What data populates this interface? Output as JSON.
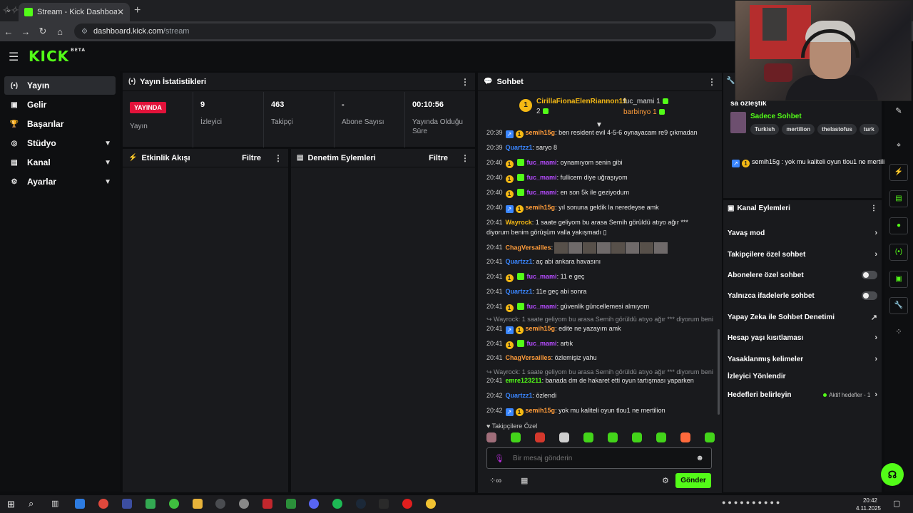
{
  "browser": {
    "tab_title": "Stream - Kick Dashboard",
    "tab_close": "✕",
    "new_tab": "+",
    "address_host": "dashboard.kick.com",
    "address_path": "/stream"
  },
  "header": {
    "logo": "KICK",
    "logo_badge": "BETA"
  },
  "sidebar": {
    "items": [
      {
        "label": "Yayın",
        "icon": "(•)"
      },
      {
        "label": "Gelir",
        "icon": "▣"
      },
      {
        "label": "Başarılar",
        "icon": "🏆"
      },
      {
        "label": "Stüdyo",
        "icon": "◎"
      },
      {
        "label": "Kanal",
        "icon": "▤"
      },
      {
        "label": "Ayarlar",
        "icon": "⚙"
      }
    ]
  },
  "stats": {
    "title": "Yayın İstatistikleri",
    "live_badge": "YAYINDA",
    "live_label": "Yayın",
    "viewers_value": "9",
    "viewers_label": "İzleyici",
    "followers_value": "463",
    "followers_label": "Takipçi",
    "subs_value": "-",
    "subs_label": "Abone Sayısı",
    "uptime_value": "00:10:56",
    "uptime_label": "Yayında Olduğu Süre"
  },
  "activity": {
    "title": "Etkinlik Akışı",
    "filter": "Filtre"
  },
  "moderation": {
    "title": "Denetim Eylemleri",
    "filter": "Filtre"
  },
  "chat": {
    "title": "Sohbet",
    "pinned": {
      "top_gifter": "CirillaFionaElenRiannon19",
      "top_count": "2",
      "rank_badge": "1",
      "user1": "fuc_mami",
      "user1_count": "1",
      "user2": "barbinyo",
      "user2_count": "1"
    },
    "messages": [
      {
        "ts": "20:39",
        "user": "semih15g",
        "color": "#ff9c3a",
        "badges": [
          "blue",
          "gold"
        ],
        "text": ": ben resident evil 4-5-6 oynayacam re9 çıkmadan"
      },
      {
        "ts": "20:39",
        "user": "Quartzz1",
        "color": "#3a86ff",
        "badges": [],
        "text": ": saryo 8"
      },
      {
        "ts": "20:40",
        "user": "fuc_mami",
        "color": "#b64bff",
        "badges": [
          "gold",
          "green"
        ],
        "text": ": oynamıyom senin gibi"
      },
      {
        "ts": "20:40",
        "user": "fuc_mami",
        "color": "#b64bff",
        "badges": [
          "gold",
          "green"
        ],
        "text": ": fullicem diye uğraşıyom"
      },
      {
        "ts": "20:40",
        "user": "fuc_mami",
        "color": "#b64bff",
        "badges": [
          "gold",
          "green"
        ],
        "text": ": en son 5k ile geziyodum"
      },
      {
        "ts": "20:40",
        "user": "semih15g",
        "color": "#ff9c3a",
        "badges": [
          "blue",
          "gold"
        ],
        "text": ": yıl sonuna geldik la neredeyse amk"
      },
      {
        "ts": "20:41",
        "user": "Wayrock",
        "color": "#f5b914",
        "badges": [],
        "text": ": 1 saate geliyom bu arasa Semih görüldü atıyo ağır ***"
      },
      {
        "ts": "",
        "user": "",
        "color": "#e8e8e8",
        "badges": [],
        "text": "diyorum benim görüşüm valla yakışmadı ▯"
      },
      {
        "ts": "20:41",
        "user": "ChagVersailles",
        "color": "#ff9c3a",
        "badges": [],
        "text": ":"
      },
      {
        "ts": "20:41",
        "user": "Quartzz1",
        "color": "#3a86ff",
        "badges": [],
        "text": ": aç abi ankara havasını"
      },
      {
        "ts": "20:41",
        "user": "fuc_mami",
        "color": "#b64bff",
        "badges": [
          "gold",
          "green"
        ],
        "text": ": 11 e geç"
      },
      {
        "ts": "20:41",
        "user": "Quartzz1",
        "color": "#3a86ff",
        "badges": [],
        "text": ": 11e geç abi sonra"
      },
      {
        "ts": "20:41",
        "user": "fuc_mami",
        "color": "#b64bff",
        "badges": [
          "gold",
          "green"
        ],
        "text": ": güvenlik güncellemesi almıyom"
      },
      {
        "ts": "",
        "user": "",
        "color": "#8c8e92",
        "badges": [],
        "text": "↪ Wayrock: 1 saate geliyom bu arasa Semih görüldü atıyo ağır *** diyorum beni..."
      },
      {
        "ts": "20:41",
        "user": "semih15g",
        "color": "#ff9c3a",
        "badges": [
          "blue",
          "gold"
        ],
        "text": ": edite ne yazayım amk"
      },
      {
        "ts": "20:41",
        "user": "fuc_mami",
        "color": "#b64bff",
        "badges": [
          "gold",
          "green"
        ],
        "text": ": artık"
      },
      {
        "ts": "20:41",
        "user": "ChagVersailles",
        "color": "#ff9c3a",
        "badges": [],
        "text": ": özlemişiz yahu"
      },
      {
        "ts": "",
        "user": "",
        "color": "#8c8e92",
        "badges": [],
        "text": "↪ Wayrock: 1 saate geliyom bu arasa Semih görüldü atıyo ağır *** diyorum beni..."
      },
      {
        "ts": "20:41",
        "user": "emre123211",
        "color": "#53fc18",
        "badges": [],
        "text": ": banada dm de hakaret etti oyun tartışması yaparken"
      },
      {
        "ts": "20:42",
        "user": "Quartzz1",
        "color": "#3a86ff",
        "badges": [],
        "text": ": özlendi"
      },
      {
        "ts": "20:42",
        "user": "semih15g",
        "color": "#ff9c3a",
        "badges": [
          "blue",
          "gold"
        ],
        "text": ": yok mu kaliteli oyun tlou1 ne mertilion"
      }
    ],
    "followers_only": "♥ Takipçilere Özel",
    "input_placeholder": "Bir mesaj gönderin",
    "send": "Gönder"
  },
  "stream_info": {
    "cut_title": "sa özleştik",
    "category": "Sadece Sohbet",
    "tags": [
      "Turkish",
      "mertilion",
      "thelastofus",
      "turk"
    ],
    "pinned_message_user": "semih15g",
    "pinned_message_text": " : yok mu kaliteli oyun tlou1 ne mertilion"
  },
  "channel_actions": {
    "title": "Kanal Eylemleri",
    "items": [
      {
        "label": "Yavaş mod",
        "kind": "chevron"
      },
      {
        "label": "Takipçilere özel sohbet",
        "kind": "chevron"
      },
      {
        "label": "Abonelere özel sohbet",
        "kind": "toggle"
      },
      {
        "label": "Yalnızca ifadelerle sohbet",
        "kind": "toggle"
      },
      {
        "label": "Yapay Zeka ile Sohbet Denetimi",
        "kind": "external"
      },
      {
        "label": "Hesap yaşı kısıtlaması",
        "kind": "chevron"
      },
      {
        "label": "Yasaklanmış kelimeler",
        "kind": "chevron"
      },
      {
        "label": "İzleyici Yönlendir",
        "kind": "none"
      },
      {
        "label": "Hedefleri belirleyin",
        "kind": "goal"
      }
    ],
    "goal_status": "Aktif hedefler - 1"
  },
  "taskbar": {
    "time": "20:42",
    "date": "4.11.2025"
  },
  "colors": {
    "accent": "#53fc18",
    "live": "#e2123a",
    "panel": "#191a1d"
  }
}
